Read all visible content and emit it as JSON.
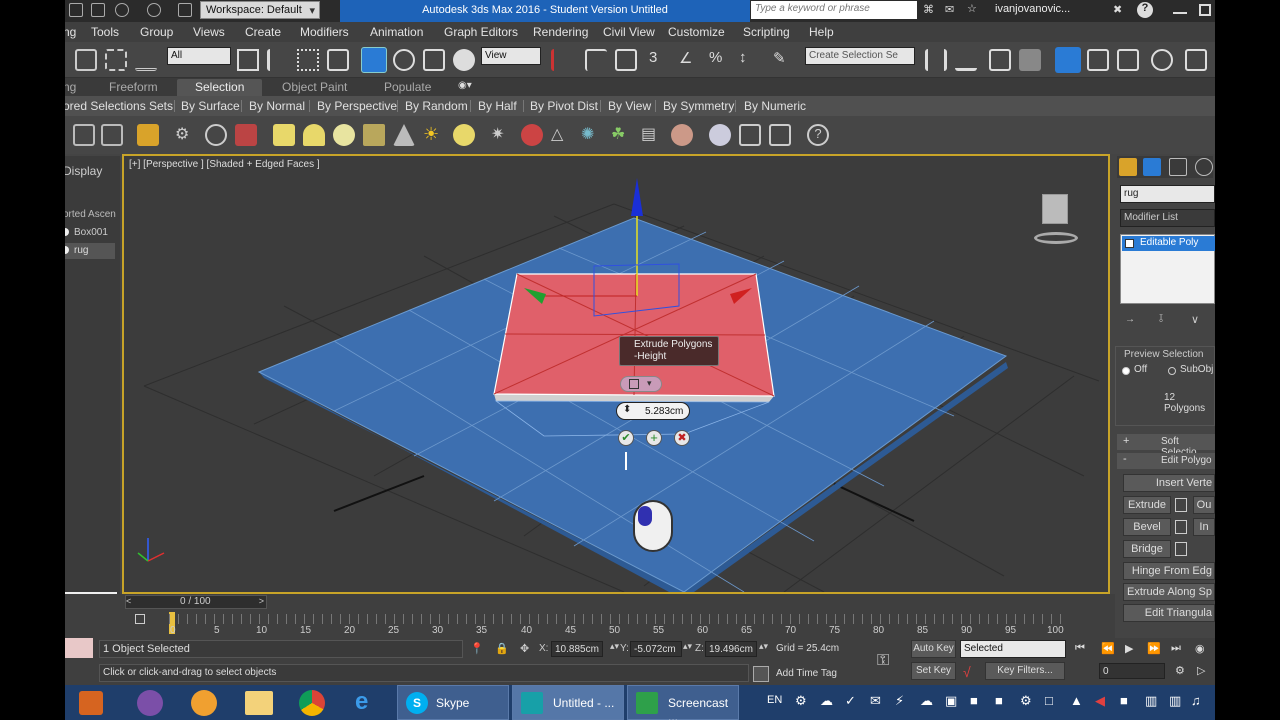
{
  "title_bar": {
    "workspace": "Workspace: Default",
    "window_title": "Autodesk 3ds Max 2016 - Student Version    Untitled",
    "search_placeholder": "Type a keyword or phrase",
    "user": "ivanjovanovic..."
  },
  "menu": [
    "ng",
    "Tools",
    "Group",
    "Views",
    "Create",
    "Modifiers",
    "Animation",
    "Graph Editors",
    "Rendering",
    "Civil View",
    "Customize",
    "Scripting",
    "Help"
  ],
  "toolbar": {
    "selection_filter": "All",
    "ref_coord": "View",
    "named_selection": "Create Selection Se"
  },
  "ribbon": {
    "tabs": [
      "ng",
      "Freeform",
      "Selection",
      "Object Paint",
      "Populate"
    ],
    "active_tab": "Selection",
    "sub_items": [
      "ored Selections",
      "Sets",
      "By Surface",
      "By Normal",
      "By Perspective",
      "By Random",
      "By Half",
      "By Pivot Dist",
      "By View",
      "By Symmetry",
      "By Numeric"
    ]
  },
  "scene_explorer": {
    "tab": "Display",
    "header": "orted Ascen",
    "items": [
      "Box001",
      "rug"
    ]
  },
  "viewport": {
    "label": "[+] [Perspective ] [Shaded + Edged Faces ]",
    "caddy_title_1": "Extrude Polygons",
    "caddy_title_2": "-Height",
    "caddy_value": "5.283cm"
  },
  "command_panel": {
    "object_name": "rug",
    "modifier_list": "Modifier List",
    "stack_item": "Editable Poly",
    "preview_selection": "Preview Selection",
    "preview_off": "Off",
    "preview_subobj": "SubObj",
    "polygons_count": "12 Polygons",
    "soft_selection": "Soft Selectio",
    "edit_polygons": "Edit Polygo",
    "insert_vertex": "Insert Verte",
    "extrude": "Extrude",
    "outline": "Ou",
    "bevel": "Bevel",
    "inset": "In",
    "bridge": "Bridge",
    "hinge": "Hinge From Edg",
    "extrude_spline": "Extrude Along Sp",
    "edit_tri": "Edit Triangula"
  },
  "timeline": {
    "frame": "0 / 100",
    "ticks": [
      "0",
      "5",
      "10",
      "15",
      "20",
      "25",
      "30",
      "35",
      "40",
      "45",
      "50",
      "55",
      "60",
      "65",
      "70",
      "75",
      "80",
      "85",
      "90",
      "95",
      "100"
    ]
  },
  "status": {
    "selected": "1 Object Selected",
    "prompt": "Click or click-and-drag to select objects",
    "x": "10.885cm",
    "y": "-5.072cm",
    "z": "19.496cm",
    "x_label": "X:",
    "y_label": "Y:",
    "z_label": "Z:",
    "grid": "Grid = 25.4cm",
    "add_time_tag": "Add Time Tag",
    "auto_key": "Auto Key",
    "set_key": "Set Key",
    "key_mode": "Selected",
    "key_filters": "Key Filters...",
    "current_frame": "0"
  },
  "taskbar": {
    "skype": "Skype",
    "untitled": "Untitled - ...",
    "screencast": "Screencast ...",
    "lang": "EN"
  },
  "colors": {
    "plane_blue": "#3d6fb0",
    "rug_red": "#e0606a",
    "viewport_border": "#c8a428"
  }
}
